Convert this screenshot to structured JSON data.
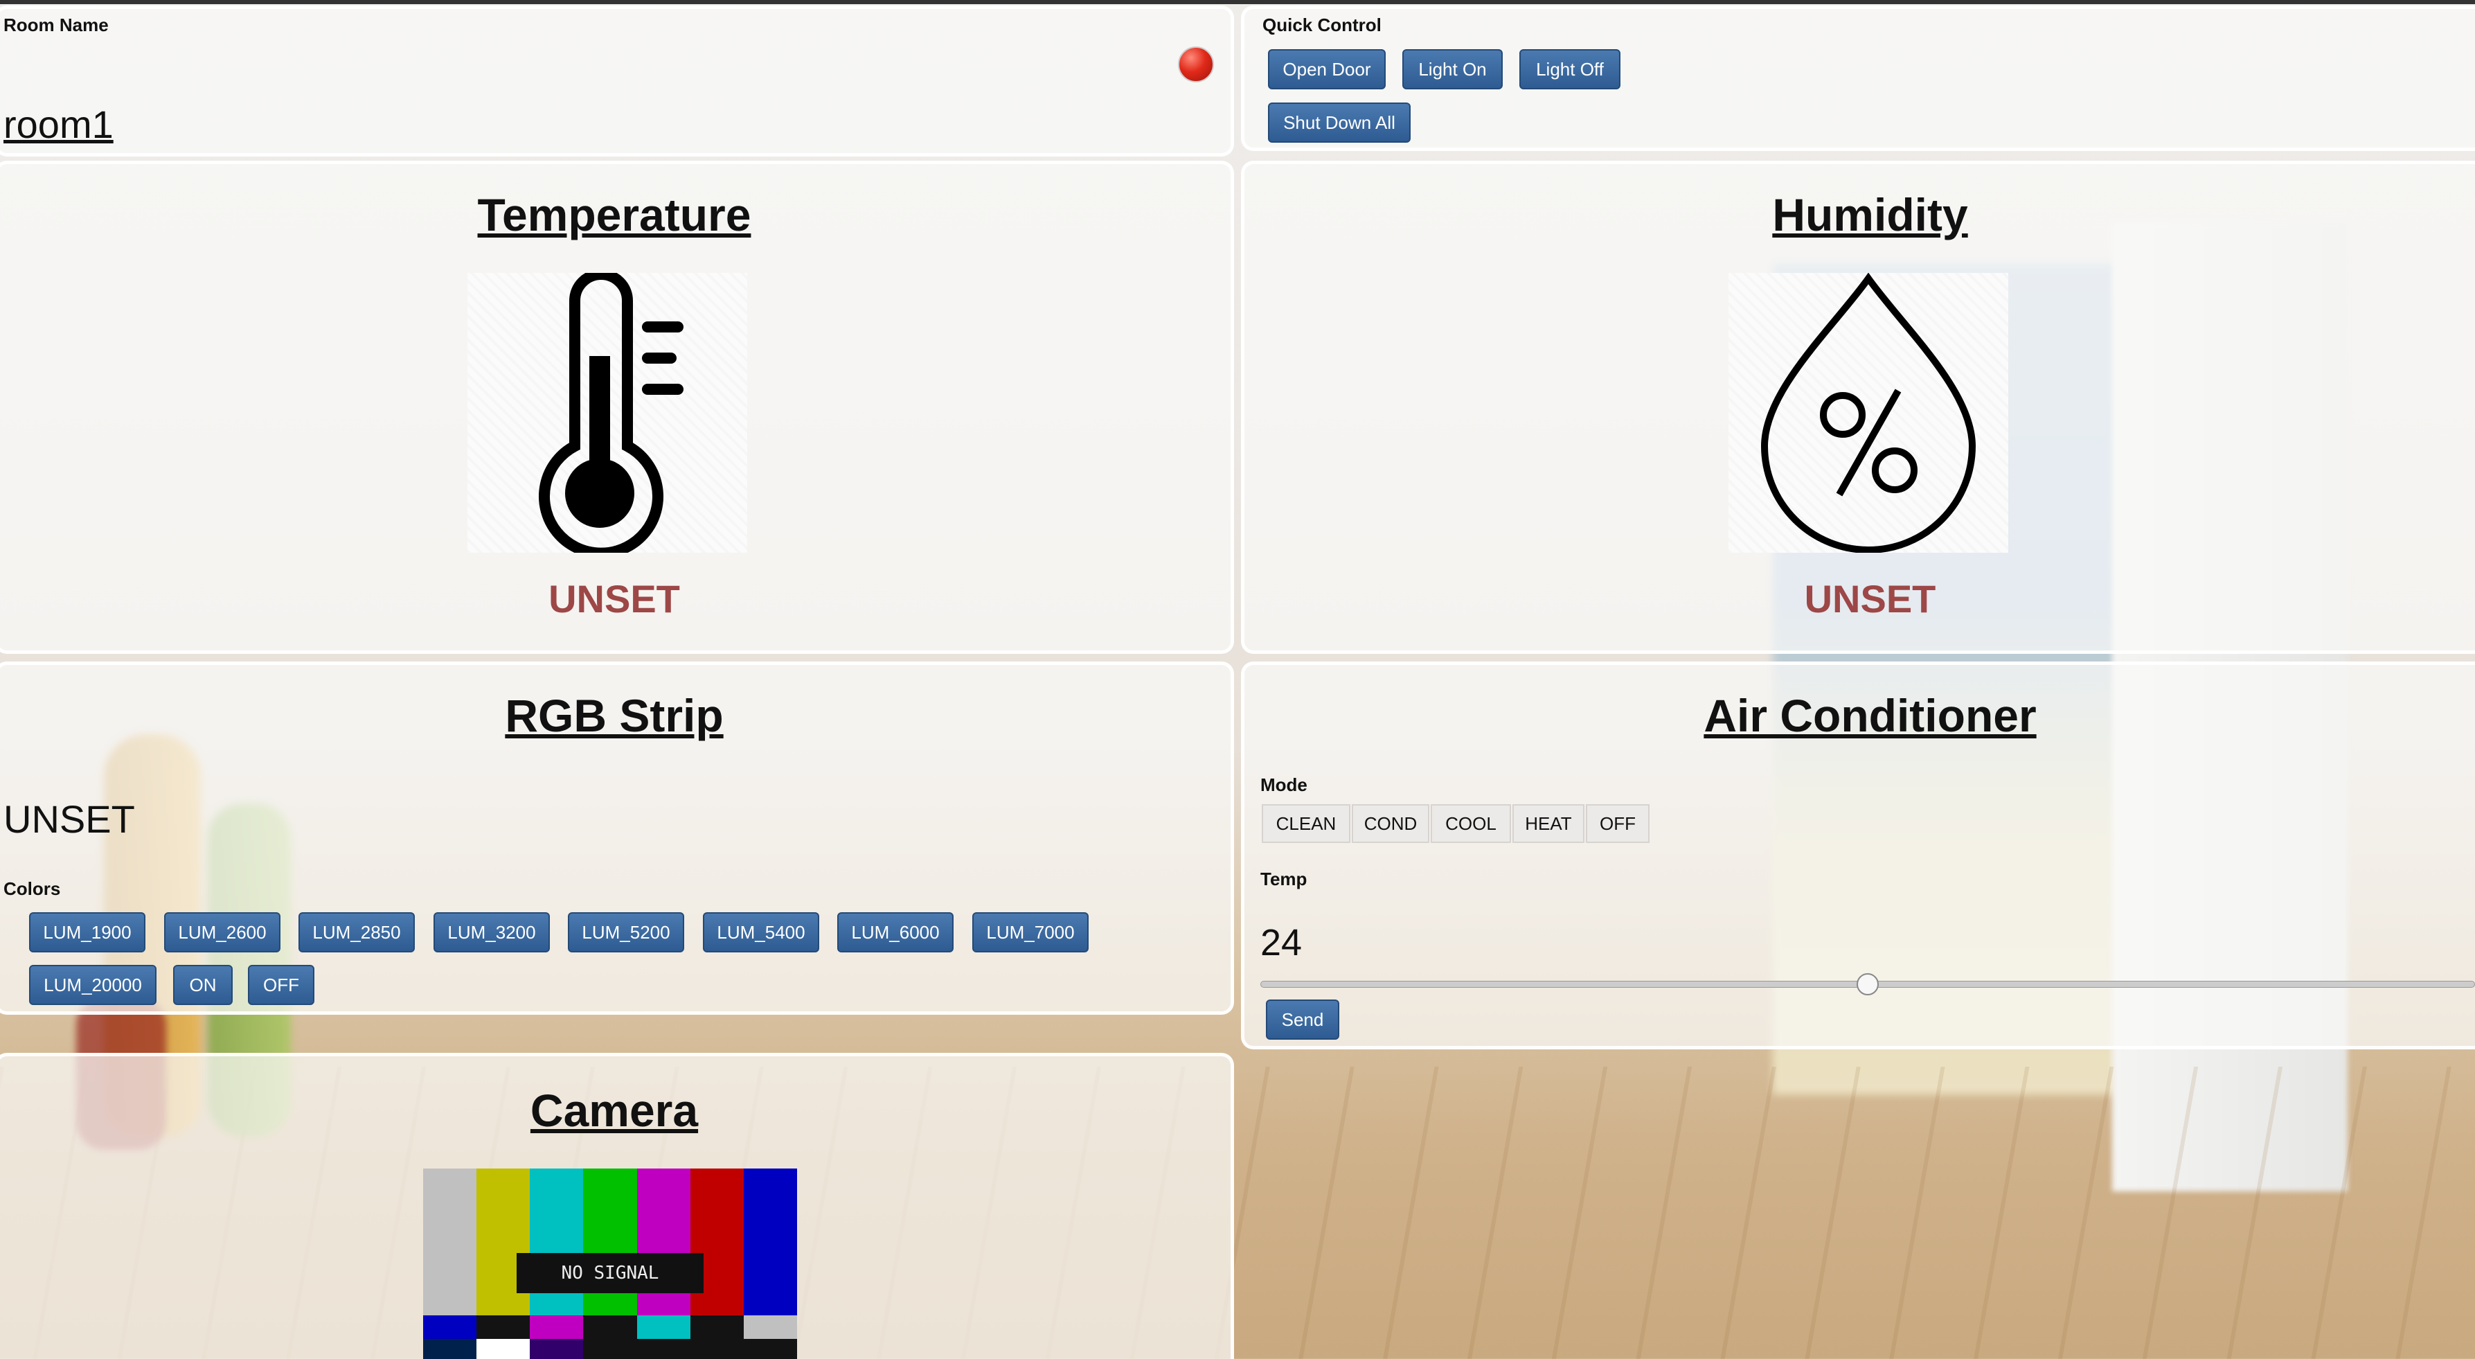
{
  "room": {
    "label": "Room Name",
    "name": "room1",
    "status_color": "#e02a1a"
  },
  "quick_control": {
    "label": "Quick Control",
    "buttons": [
      "Open Door",
      "Light On",
      "Light Off",
      "Shut Down All"
    ]
  },
  "temperature": {
    "title": "Temperature",
    "value": "UNSET",
    "icon": "thermometer-icon"
  },
  "humidity": {
    "title": "Humidity",
    "value": "UNSET",
    "icon": "humidity-drop-icon"
  },
  "rgb_strip": {
    "title": "RGB Strip",
    "value": "UNSET",
    "colors_label": "Colors",
    "buttons": [
      "LUM_1900",
      "LUM_2600",
      "LUM_2850",
      "LUM_3200",
      "LUM_5200",
      "LUM_5400",
      "LUM_6000",
      "LUM_7000",
      "LUM_20000",
      "ON",
      "OFF"
    ]
  },
  "air_conditioner": {
    "title": "Air Conditioner",
    "mode_label": "Mode",
    "modes": [
      "CLEAN",
      "COND",
      "COOL",
      "HEAT",
      "OFF"
    ],
    "temp_label": "Temp",
    "temp_value": "24",
    "temp_slider_fraction": 0.5,
    "send_label": "Send"
  },
  "camera": {
    "title": "Camera",
    "feed_text": "NO SIGNAL"
  },
  "colors": {
    "button": "#2e5c92",
    "unset": "#9d4747"
  }
}
